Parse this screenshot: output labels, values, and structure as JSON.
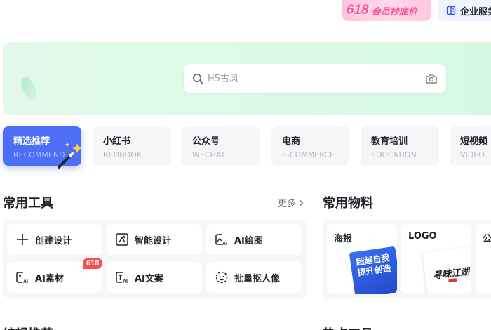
{
  "topbar": {
    "promo_number": "618",
    "promo_text": "会员抄底价",
    "enterprise_label": "企业服务"
  },
  "search": {
    "placeholder": "H5古风"
  },
  "tabs": [
    {
      "title": "精选推荐",
      "subtitle": "RECOMMEND",
      "active": true
    },
    {
      "title": "小红书",
      "subtitle": "REDBOOK"
    },
    {
      "title": "公众号",
      "subtitle": "WECHAT"
    },
    {
      "title": "电商",
      "subtitle": "E-COMMERCE"
    },
    {
      "title": "教育培训",
      "subtitle": "EDUCATION"
    },
    {
      "title": "短视频",
      "subtitle": "VIDEO"
    }
  ],
  "tools_section": {
    "title": "常用工具",
    "more_label": "更多",
    "items": [
      {
        "label": "创建设计",
        "icon": "plus-icon"
      },
      {
        "label": "智能设计",
        "icon": "smart-design-icon"
      },
      {
        "label": "AI绘图",
        "icon": "ai-image-icon"
      },
      {
        "label": "AI素材",
        "icon": "ai-material-icon",
        "badge": "618"
      },
      {
        "label": "AI文案",
        "icon": "ai-text-icon"
      },
      {
        "label": "批量抠人像",
        "icon": "face-cutout-icon"
      }
    ]
  },
  "materials_section": {
    "title": "常用物料",
    "items": [
      {
        "label": "海报",
        "thumb_title": "超越自我 提升创造"
      },
      {
        "label": "LOGO",
        "thumb_title": "寻味江湖"
      },
      {
        "label": "公"
      }
    ]
  },
  "bottom": {
    "left_heading": "编辑推荐",
    "right_heading": "热点工具"
  },
  "colors": {
    "accent": "#4d6ef7",
    "promo_pink": "#ff4f9a",
    "badge_red": "#ff4d4f",
    "banner_green": "#dbfae6"
  }
}
